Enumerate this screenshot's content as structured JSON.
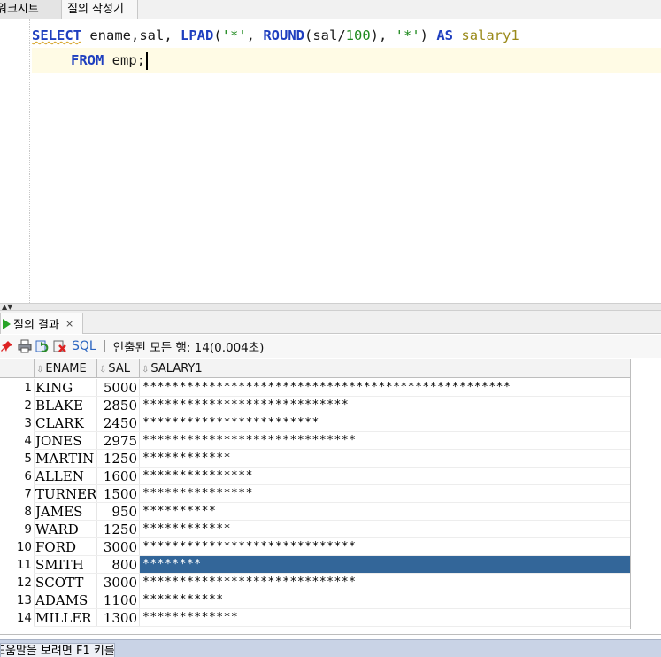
{
  "top_tabs": [
    "워크시트",
    "질의 작성기"
  ],
  "editor": {
    "line1": {
      "select": "SELECT",
      "text1": " ename,sal, ",
      "lpad": "LPAD",
      "text2": "(",
      "str1": "'*'",
      "text3": ", ",
      "round": "ROUND",
      "text4": "(sal/",
      "num1": "100",
      "text5": "), ",
      "str2": "'*'",
      "text6": ") ",
      "as": "AS",
      "text7": " ",
      "alias": "salary1"
    },
    "line2": {
      "from": "FROM",
      "text1": " emp;"
    }
  },
  "results": {
    "tab_label": "질의 결과",
    "close": "×",
    "toolbar_sql": "SQL",
    "status_text": "인출된 모든 행: 14(0.004초)",
    "columns": [
      "ENAME",
      "SAL",
      "SALARY1"
    ],
    "rows": [
      {
        "n": "1",
        "ename": "KING",
        "sal": "5000",
        "salary1": "**************************************************"
      },
      {
        "n": "2",
        "ename": "BLAKE",
        "sal": "2850",
        "salary1": "****************************"
      },
      {
        "n": "3",
        "ename": "CLARK",
        "sal": "2450",
        "salary1": "************************"
      },
      {
        "n": "4",
        "ename": "JONES",
        "sal": "2975",
        "salary1": "*****************************"
      },
      {
        "n": "5",
        "ename": "MARTIN",
        "sal": "1250",
        "salary1": "************"
      },
      {
        "n": "6",
        "ename": "ALLEN",
        "sal": "1600",
        "salary1": "***************"
      },
      {
        "n": "7",
        "ename": "TURNER",
        "sal": "1500",
        "salary1": "***************"
      },
      {
        "n": "8",
        "ename": "JAMES",
        "sal": "950",
        "salary1": "**********"
      },
      {
        "n": "9",
        "ename": "WARD",
        "sal": "1250",
        "salary1": "************"
      },
      {
        "n": "10",
        "ename": "FORD",
        "sal": "3000",
        "salary1": "*****************************"
      },
      {
        "n": "11",
        "ename": "SMITH",
        "sal": "800",
        "salary1": "********"
      },
      {
        "n": "12",
        "ename": "SCOTT",
        "sal": "3000",
        "salary1": "*****************************"
      },
      {
        "n": "13",
        "ename": "ADAMS",
        "sal": "1100",
        "salary1": "***********"
      },
      {
        "n": "14",
        "ename": "MILLER",
        "sal": "1300",
        "salary1": "*************"
      }
    ],
    "selected_row": 11
  },
  "status_bar": {
    "label": "도움말을 보려면 F1 키를 누르십시오"
  }
}
